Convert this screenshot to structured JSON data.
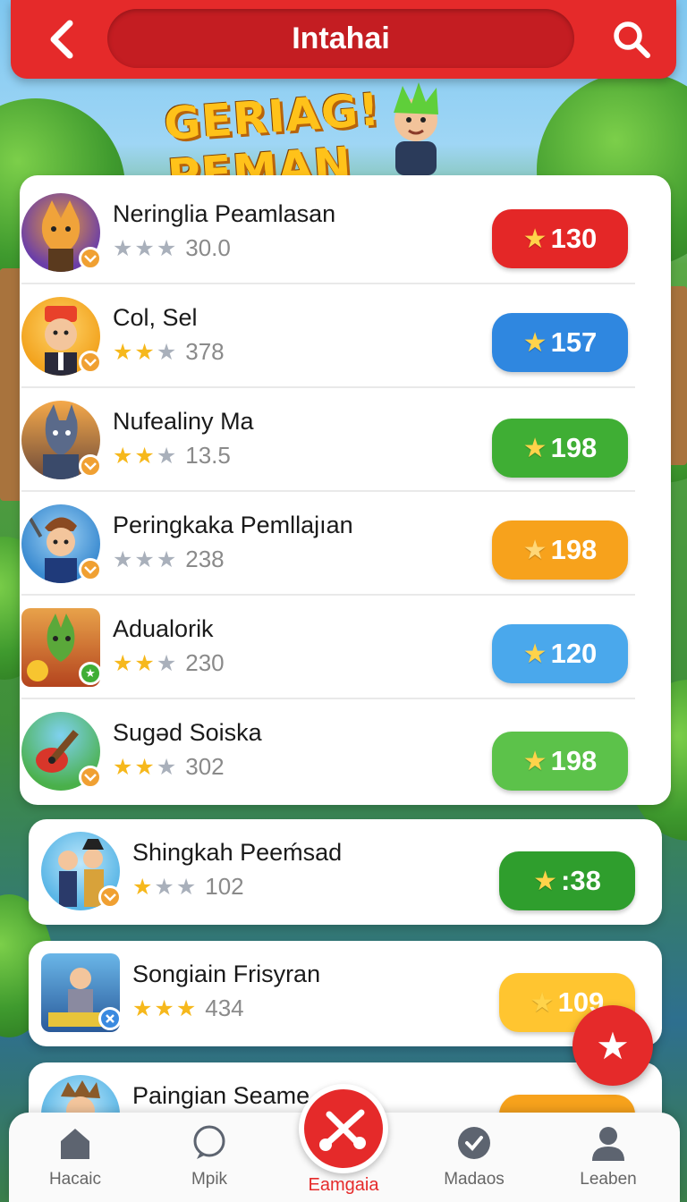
{
  "header": {
    "title": "Intahai",
    "back_icon": "chevron-left-icon",
    "search_icon": "search-icon"
  },
  "banner": {
    "text": "GERIAG! PEMAN"
  },
  "list": [
    {
      "name": "Neringlia Peamlasan",
      "stars": 0,
      "score": "30.0",
      "points": "130",
      "color": "#e42727"
    },
    {
      "name": "Col, Sel",
      "stars": 2,
      "score": "378",
      "points": "157",
      "color": "#2f87e0"
    },
    {
      "name": "Nufealiny Ma",
      "stars": 2,
      "score": "13.5",
      "points": "198",
      "color": "#3fae34"
    },
    {
      "name": "Peringkaka Pemllajıan",
      "stars": 0,
      "score": "238",
      "points": "198",
      "color": "#f7a21c"
    },
    {
      "name": "Adualorik",
      "stars": 2,
      "score": "230",
      "points": "120",
      "color": "#4aa8ec"
    },
    {
      "name": "Sugəd Soiska",
      "stars": 2,
      "score": "302",
      "points": "198",
      "color": "#5cc24a"
    },
    {
      "name": "Shingkah Peeḿsad",
      "stars": 1,
      "score": "102",
      "points": ":38",
      "color": "#2f9e2d"
    },
    {
      "name": "Songiain Frisyran",
      "stars": 3,
      "score": "434",
      "points": "109",
      "color": "#ffc530"
    },
    {
      "name": "Paingian Seame",
      "stars": 0,
      "score": "",
      "points": "",
      "color": "#f7a21c"
    }
  ],
  "fab": {
    "icon": "star-icon"
  },
  "bottom_nav": {
    "items": [
      {
        "label": "Hacaic",
        "icon": "home-icon"
      },
      {
        "label": "Mpik",
        "icon": "chat-bubble-icon"
      },
      {
        "label": "Madaos",
        "icon": "check-circle-icon"
      },
      {
        "label": "Leaben",
        "icon": "user-icon"
      }
    ],
    "center": {
      "label": "Eamgaia",
      "icon": "tools-icon"
    }
  }
}
